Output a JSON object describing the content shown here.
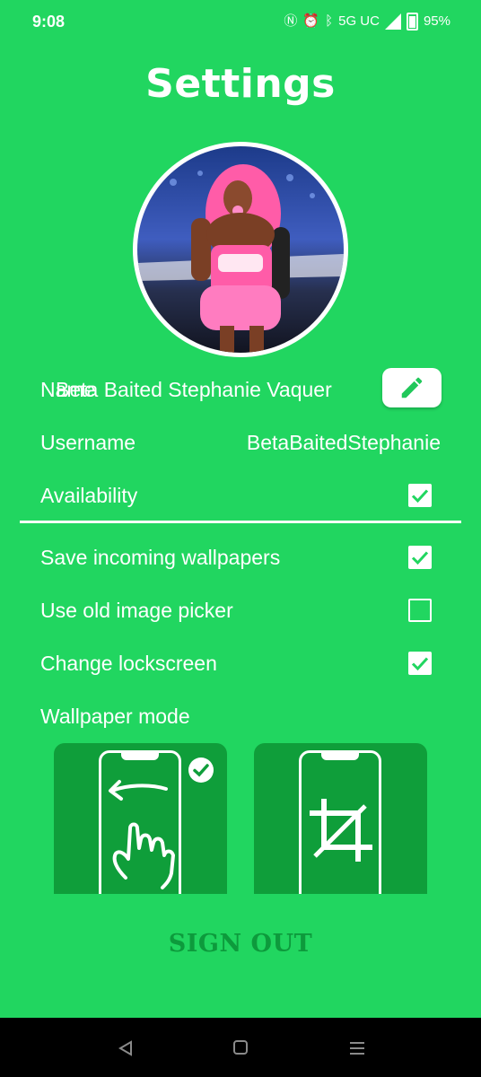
{
  "status_bar": {
    "time": "9:08",
    "network": "5G UC",
    "battery": "95%",
    "icons": [
      "nfc-icon",
      "alarm-icon",
      "bluetooth-icon",
      "signal-icon",
      "battery-icon"
    ]
  },
  "header": {
    "title": "Settings"
  },
  "profile": {
    "avatar": "profile-photo"
  },
  "fields": {
    "name_label": "Name",
    "name_value": "Beta Baited Stephanie Vaquer",
    "username_label": "Username",
    "username_value": "BetaBaitedStephanie",
    "availability_label": "Availability",
    "availability_checked": true
  },
  "options": [
    {
      "label": "Save incoming wallpapers",
      "checked": true
    },
    {
      "label": "Use old image picker",
      "checked": false
    },
    {
      "label": "Change lockscreen",
      "checked": true
    }
  ],
  "wallpaper_mode": {
    "label": "Wallpaper mode",
    "modes": [
      {
        "name": "scroll",
        "selected": true
      },
      {
        "name": "crop",
        "selected": false
      }
    ]
  },
  "actions": {
    "sign_out": "SIGN OUT"
  },
  "colors": {
    "background": "#21d660",
    "card": "#0f9e3a",
    "accent_text": "#0d9a3c"
  }
}
